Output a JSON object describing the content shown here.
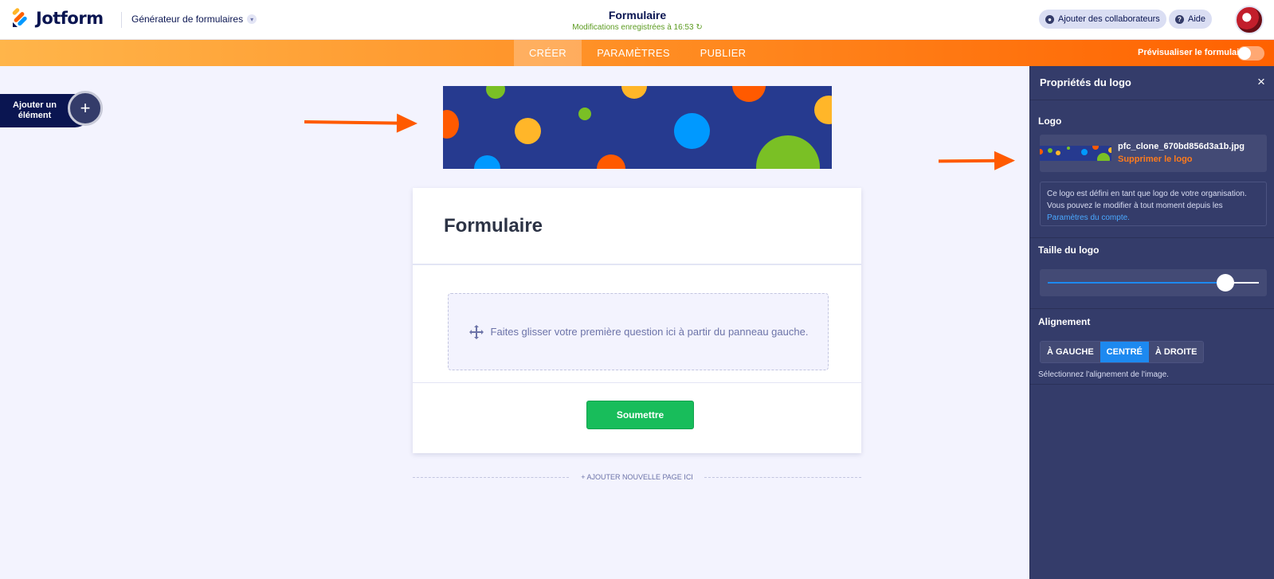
{
  "header": {
    "brand": "Jotform",
    "builder_menu": "Générateur de formulaires",
    "form_title": "Formulaire",
    "saved_status": "Modifications enregistrées à 16:53",
    "collaborators_label": "Ajouter des collaborateurs",
    "help_label": "Aide"
  },
  "nav": {
    "tabs": [
      {
        "label": "CRÉER",
        "active": true
      },
      {
        "label": "PARAMÈTRES",
        "active": false
      },
      {
        "label": "PUBLIER",
        "active": false
      }
    ],
    "preview_label": "Prévisualiser le formulaire",
    "preview_enabled": false
  },
  "left": {
    "add_element_label": "Ajouter un élément",
    "add_icon": "+"
  },
  "form": {
    "heading": "Formulaire",
    "dropzone_text": "Faites glisser votre première question ici à partir du panneau gauche.",
    "submit_label": "Soumettre",
    "add_page_label": "+ AJOUTER NOUVELLE PAGE ICI"
  },
  "panel": {
    "title": "Propriétés du logo",
    "close_icon": "×",
    "logo_section": "Logo",
    "file_name": "pfc_clone_670bd856d3a1b.jpg",
    "remove_label": "Supprimer le logo",
    "info_text": "Ce logo est défini en tant que logo de votre organisation. Vous pouvez le modifier à tout moment depuis les",
    "info_link": "Paramètres du compte.",
    "size_section": "Taille du logo",
    "size_value": 0.84,
    "alignment_section": "Alignement",
    "alignment_options": [
      "À GAUCHE",
      "CENTRÉ",
      "À DROITE"
    ],
    "alignment_selected": "CENTRÉ",
    "alignment_hint": "Sélectionnez l'alignement de l'image."
  },
  "colors": {
    "accent_orange": "#ff6100",
    "panel_bg": "#343c6a",
    "submit_green": "#18bd5b",
    "selected_blue": "#1d89f0",
    "banner_bg": "#263a8f"
  }
}
